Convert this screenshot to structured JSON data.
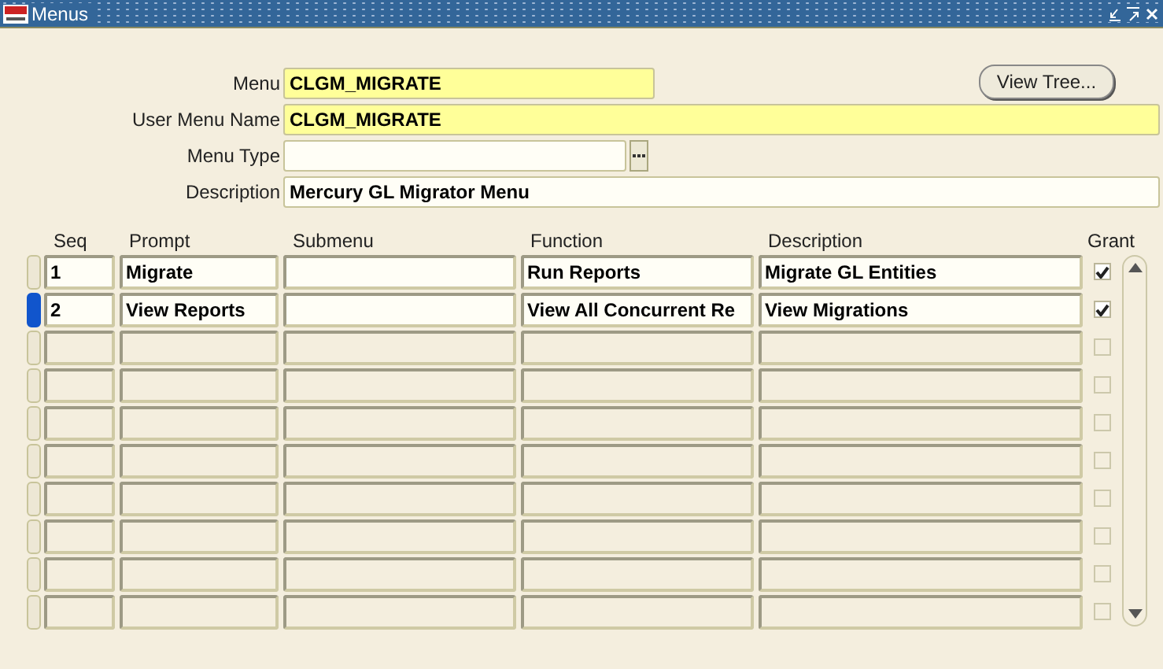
{
  "window": {
    "title": "Menus"
  },
  "form": {
    "fields": [
      {
        "label": "Menu",
        "value": "CLGM_MIGRATE",
        "required": true,
        "kind": "short"
      },
      {
        "label": "User Menu Name",
        "value": "CLGM_MIGRATE",
        "required": true,
        "kind": "wide"
      },
      {
        "label": "Menu Type",
        "required": false,
        "kind": "list"
      },
      {
        "label": "Description",
        "value": "Mercury GL Migrator Menu",
        "required": false,
        "kind": "wide"
      }
    ],
    "button": "View Tree..."
  },
  "table": {
    "columns": [
      "Seq",
      "Prompt",
      "Submenu",
      "Function",
      "Description",
      "Grant"
    ],
    "rows": [
      {
        "kind": "record",
        "selected": false,
        "seq": "1",
        "prompt": "Migrate",
        "function": "Run Reports",
        "description": "Migrate GL Entities",
        "grant": true
      },
      {
        "kind": "record",
        "selected": true,
        "seq": "2",
        "prompt": "View Reports",
        "function": "View All Concurrent Re",
        "description": "View Migrations",
        "grant": true
      },
      {
        "kind": "blank",
        "selected": false,
        "grant": false
      },
      {
        "kind": "blank",
        "selected": false,
        "grant": false
      },
      {
        "kind": "blank",
        "selected": false,
        "grant": false
      },
      {
        "kind": "blank",
        "selected": false,
        "grant": false
      },
      {
        "kind": "blank",
        "selected": false,
        "grant": false
      },
      {
        "kind": "blank",
        "selected": false,
        "grant": false
      },
      {
        "kind": "blank",
        "selected": false,
        "grant": false
      },
      {
        "kind": "blank",
        "selected": false,
        "grant": false
      }
    ]
  }
}
